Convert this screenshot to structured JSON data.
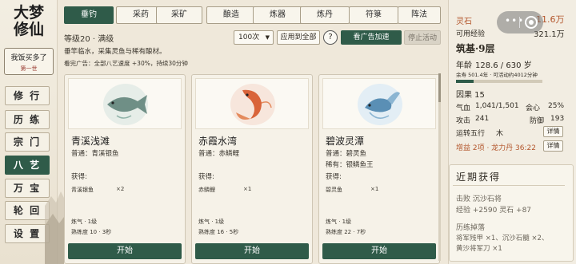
{
  "app": {
    "logo_line1": "大梦",
    "logo_line2": "修仙",
    "user_name": "我饭买多了",
    "world": "第一世"
  },
  "sidebar": {
    "items": [
      {
        "label": "修 行",
        "active": false
      },
      {
        "label": "历 练",
        "active": false
      },
      {
        "label": "宗 门",
        "active": false
      },
      {
        "label": "八 艺",
        "active": true
      },
      {
        "label": "万 宝",
        "active": false
      },
      {
        "label": "轮 回",
        "active": false
      },
      {
        "label": "设 置",
        "active": false
      }
    ]
  },
  "tabs": [
    {
      "label": "垂钓",
      "active": true
    },
    {
      "label": "采药",
      "active": false
    },
    {
      "label": "采矿",
      "active": false
    },
    {
      "label": "酿造",
      "active": false
    },
    {
      "label": "炼器",
      "active": false
    },
    {
      "label": "炼丹",
      "active": false
    },
    {
      "label": "符箓",
      "active": false
    },
    {
      "label": "阵法",
      "active": false
    }
  ],
  "info": {
    "level": "等级20 · 满级",
    "description": "垂竿临水，采集灵鱼与稀有酿材。",
    "ad_note": "看完广告：全部八艺速度 +30%，持续30分钟"
  },
  "controls": {
    "count_value": "100次",
    "apply_all": "应用到全部",
    "help": "?",
    "watch_ad": "看广告加速",
    "stop": "停止活动"
  },
  "cards": [
    {
      "name": "青溪浅滩",
      "normal": "普通：青溪银鱼",
      "rare": "",
      "gain_label": "获得:",
      "gain_item": "青溪银鱼",
      "gain_qty": "×2",
      "req_level": "炼气 · 1级",
      "proficiency": "熟练度 10 · 3秒",
      "start": "开始",
      "fish_color": "#6f8f86",
      "fish_icon": "silver-fish-icon"
    },
    {
      "name": "赤霞水湾",
      "normal": "普通：赤鳞鲤",
      "rare": "",
      "gain_label": "获得:",
      "gain_item": "赤鳞鲤",
      "gain_qty": "×1",
      "req_level": "炼气 · 1级",
      "proficiency": "熟练度 16 · 5秒",
      "start": "开始",
      "fish_color": "#d9643a",
      "fish_icon": "carp-icon"
    },
    {
      "name": "碧波灵潭",
      "normal": "普通：碧灵鱼",
      "rare": "稀有：银鳞鱼王",
      "gain_label": "获得:",
      "gain_item": "碧灵鱼",
      "gain_qty": "×1",
      "req_level": "炼气 · 1级",
      "proficiency": "熟练度 22 · 7秒",
      "start": "开始",
      "fish_color": "#5a8fb5",
      "fish_icon": "blue-fish-icon"
    }
  ],
  "stats": {
    "spirit_stone_label": "灵石",
    "spirit_stone_value": "11.6万",
    "exp_label": "可用经验",
    "exp_value": "321.1万",
    "realm": "筑基·9层",
    "age_label": "年龄",
    "age_value": "128.6 / 630 岁",
    "life_note": "余寿 501.4年 · 可活动约4012分钟",
    "life_progress": 0.2,
    "karma": "因果  15",
    "qi_label": "气血",
    "qi_value": "1,041/1,501",
    "crit_label": "会心",
    "crit_value": "25%",
    "atk_label": "攻击",
    "atk_value": "241",
    "def_label": "防御",
    "def_value": "193",
    "element_label": "运转五行",
    "element_value": "木",
    "buff_label": "增益 2项 · 龙力丹 36:22",
    "detail": "详情"
  },
  "recent": {
    "title": "近期获得",
    "line1": "击败 沉沙石将",
    "line2": "经验 +2590  灵石 +87",
    "line3": "历练掉落",
    "line4": "将军残甲 ×1、沉沙石髓 ×2、",
    "line5": "黄沙将军刀 ×1"
  },
  "colors": {
    "accent": "#2f5b49",
    "gold": "#b3562c",
    "background": "#efe8da"
  }
}
